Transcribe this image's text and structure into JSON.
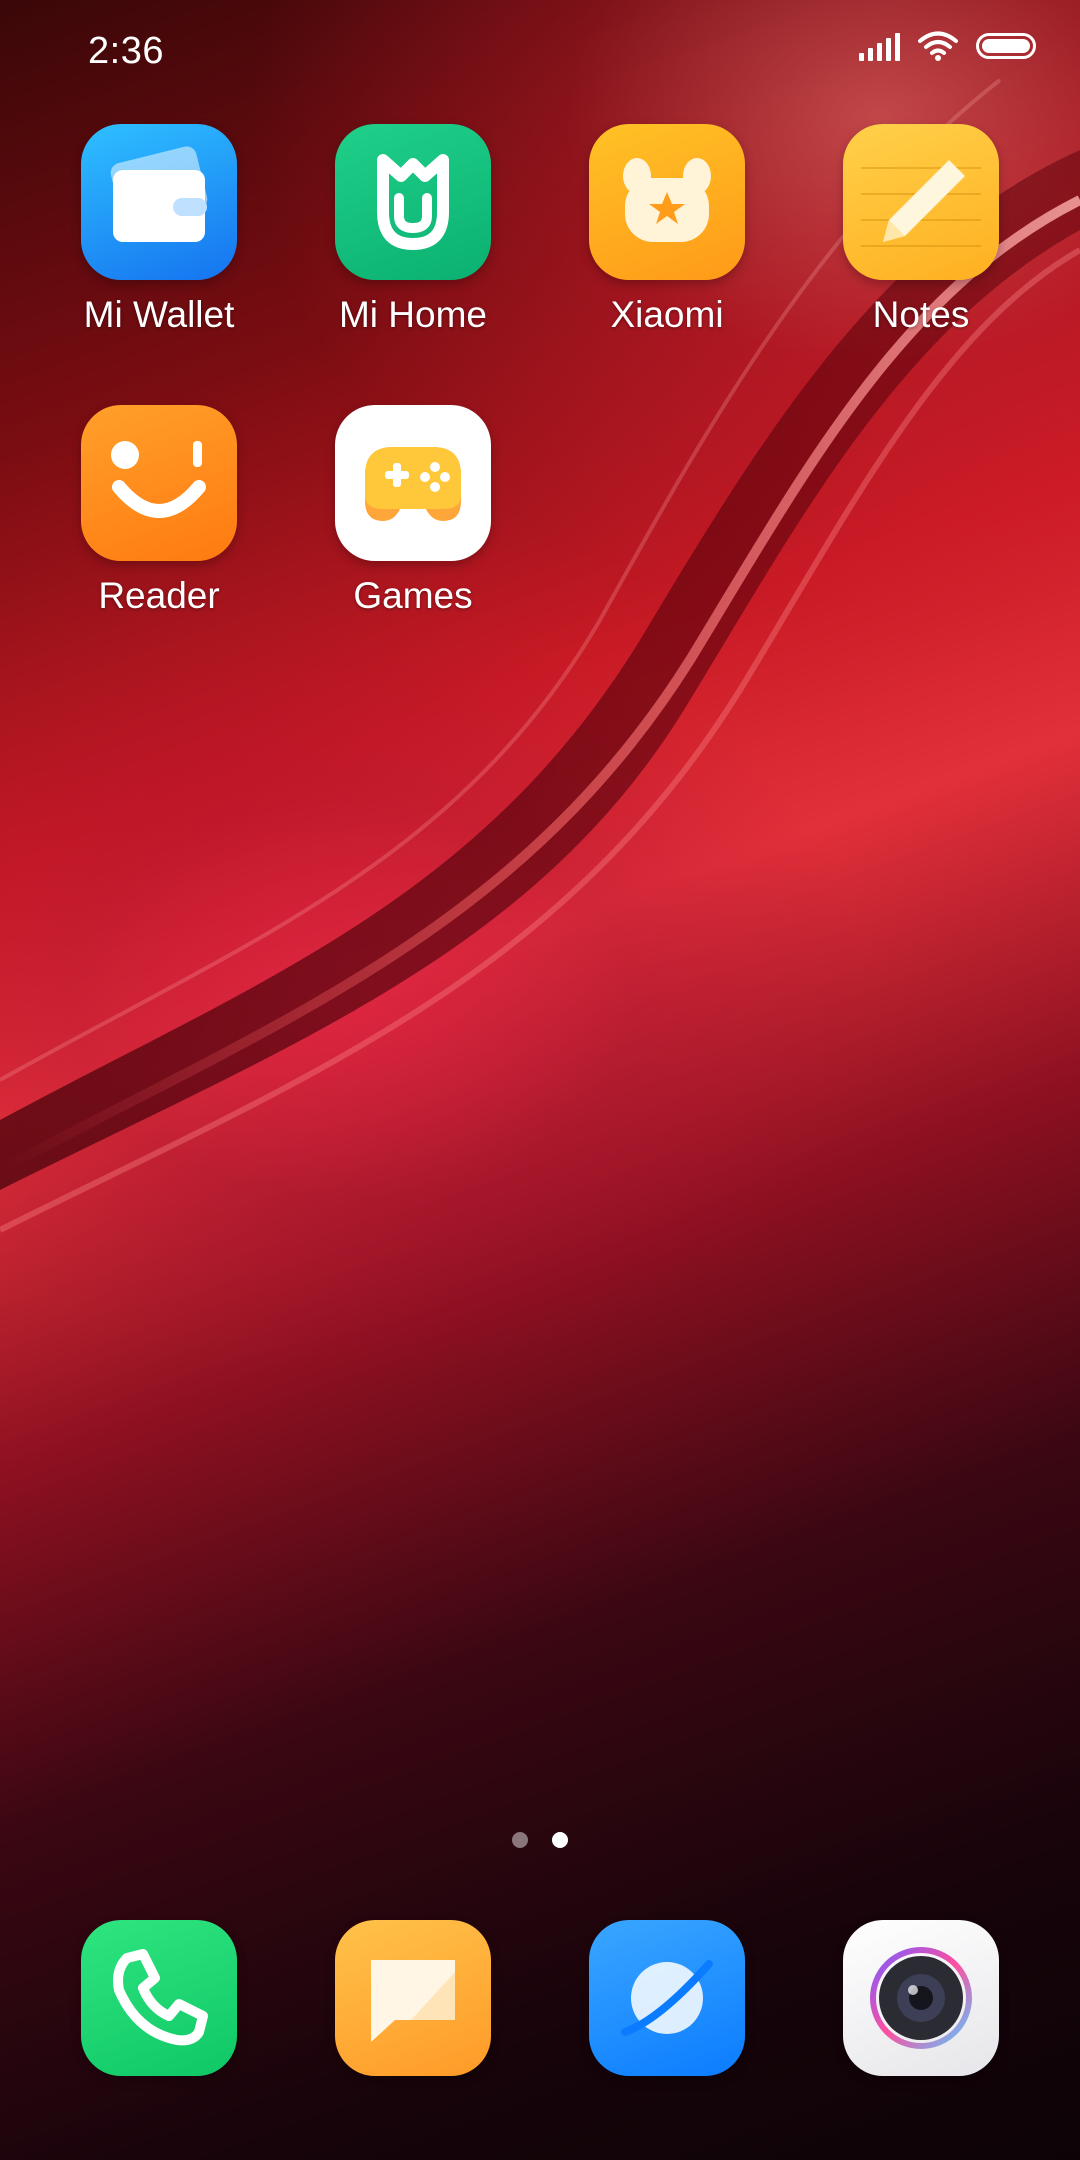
{
  "status_bar": {
    "time": "2:36",
    "icons": [
      "signal-icon",
      "wifi-icon",
      "battery-icon"
    ]
  },
  "apps": [
    {
      "label": "Mi Wallet",
      "icon": "wallet-icon",
      "color": "#2196f3"
    },
    {
      "label": "Mi Home",
      "icon": "mi-home-icon",
      "color": "#10c07d"
    },
    {
      "label": "Xiaomi",
      "icon": "mi-bunny-icon",
      "color": "#ffa51a"
    },
    {
      "label": "Notes",
      "icon": "notes-pencil-icon",
      "color": "#ffbf2e"
    },
    {
      "label": "Reader",
      "icon": "wink-face-icon",
      "color": "#ff8a12"
    },
    {
      "label": "Games",
      "icon": "gamepad-icon",
      "color": "#ffffff"
    }
  ],
  "page_indicator": {
    "count": 2,
    "active": 2
  },
  "dock": [
    {
      "icon": "phone-icon",
      "color": "#1ed66f"
    },
    {
      "icon": "messages-icon",
      "color": "#ffae3a"
    },
    {
      "icon": "browser-icon",
      "color": "#1f8fff"
    },
    {
      "icon": "camera-icon",
      "color": "#f2f2f5"
    }
  ]
}
